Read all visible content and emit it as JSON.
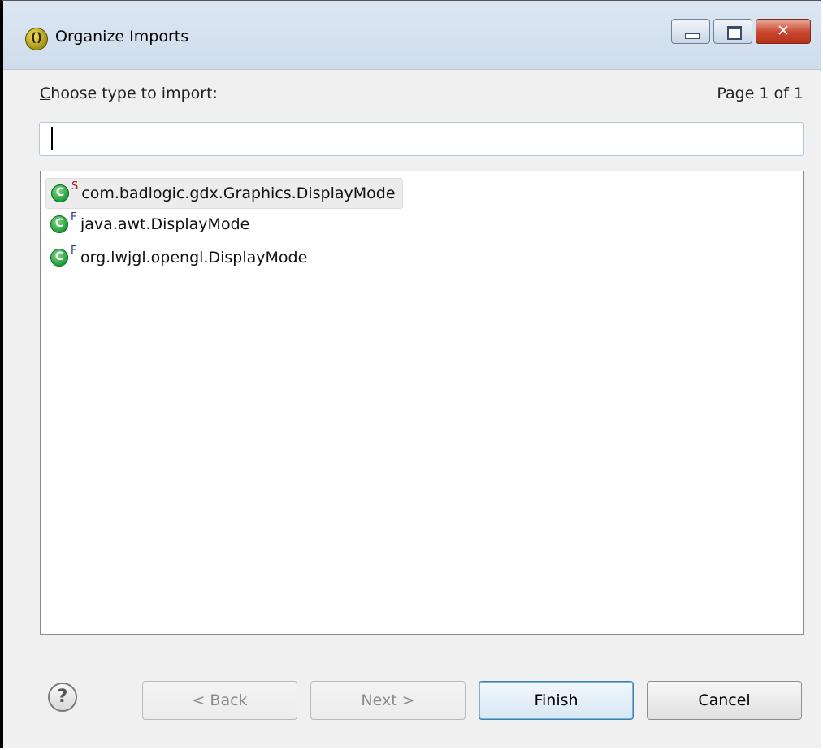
{
  "window": {
    "title": "Organize Imports",
    "controls": {
      "minimize": "minimize",
      "maximize": "maximize",
      "close": "close"
    }
  },
  "prompt": {
    "label": "Choose type to import:",
    "mnemonic": "C",
    "page_info": "Page 1 of 1"
  },
  "search": {
    "value": "",
    "placeholder": ""
  },
  "types": [
    {
      "modifier": "S",
      "name": "com.badlogic.gdx.Graphics.DisplayMode",
      "selected": true
    },
    {
      "modifier": "F",
      "name": "java.awt.DisplayMode",
      "selected": false
    },
    {
      "modifier": "F",
      "name": "org.lwjgl.opengl.DisplayMode",
      "selected": false
    }
  ],
  "buttons": {
    "back": "< Back",
    "next": "Next >",
    "finish": "Finish",
    "cancel": "Cancel"
  },
  "icons": {
    "app": "eclipse-organize-imports-icon",
    "type": "class-icon",
    "help": "help-icon"
  },
  "colors": {
    "selection": "#ececec",
    "default_button_border": "#3c7fb1",
    "static_modifier": "#a01818",
    "final_modifier": "#2a3a8c"
  }
}
